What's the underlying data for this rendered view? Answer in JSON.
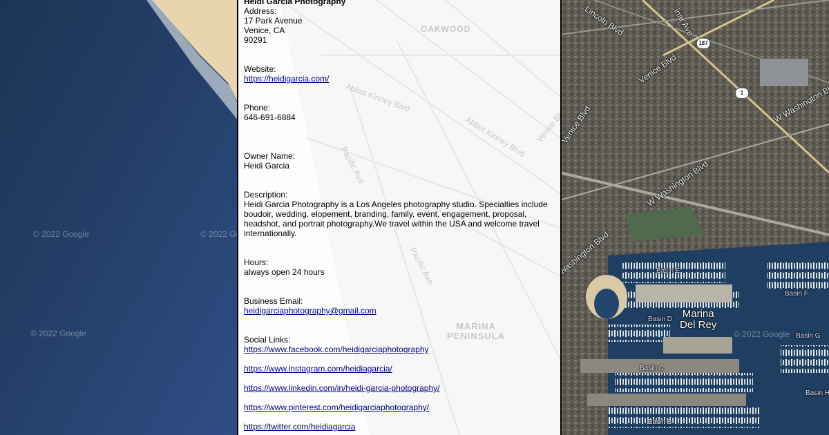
{
  "business": {
    "name": "Heidi Garcia Photography",
    "address_label": "Address:",
    "address_line1": "17 Park Avenue",
    "address_line2": "Venice, CA",
    "address_zip": "90291",
    "website_label": "Website:",
    "website": "https://heidigarcia.com/",
    "phone_label": "Phone:",
    "phone": "646-691-6884",
    "owner_label": "Owner Name:",
    "owner": "Heidi Garcia",
    "description_label": "Description:",
    "description": "Heidi Garcia Photography is a Los Angeles photography studio. Specialties include boudoir, wedding, elopement, branding, family, event, engagement, proposal, headshot, and portrait photography.We travel within the USA and welcome travel internationally.",
    "hours_label": "Hours:",
    "hours": "always open 24 hours",
    "email_label": "Business Email:",
    "email": "heidigarciaphotography@gmail.com",
    "social_label": "Social Links:",
    "social_links": [
      "https://www.facebook.com/heidigarciaphotography",
      "https://www.instagram.com/heidiagarcia/",
      "https://www.linkedin.com/in/heidi-garcia-photography/",
      "https://www.pinterest.com/heidigarciaphotography/",
      "https://twitter.com/heidiagarcia"
    ]
  },
  "map": {
    "attribution": "© 2022 Google",
    "faded_labels": {
      "oakwood": "OAKWOOD",
      "abbot_kinney_1": "Abbot Kinney Blvd",
      "abbot_kinney_2": "Abbot Kinney Blvd",
      "pacific_ave_1": "Pacific Ave",
      "pacific_ave_2": "Pacific Ave",
      "venice_blvd": "Venice Blvd",
      "marina_peninsula": "MARINA\nPENINSULA"
    },
    "road_labels": {
      "lincoln": "Lincoln Blvd",
      "venice": "Venice Blvd",
      "w_washington_1": "W Washington Blvd",
      "w_washington_2": "W Washington Blvd",
      "washington_blvd": "Washington Blvd",
      "inar_ave": "inar Ave",
      "venice_blvd_edge": "Venice Blvd"
    },
    "place_labels": {
      "marina_del_rey": "Marina\nDel Rey",
      "basin_e": "Basin E",
      "basin_d": "Basin D",
      "basin_c": "Basin C",
      "basin_b": "Basin B",
      "basin_f": "Basin F",
      "basin_g": "Basin G",
      "basin_h": "Basin H"
    },
    "shields": {
      "route_187": "187",
      "route_1": "1"
    },
    "colors": {
      "ocean": "#1e3a5c",
      "beach": "#e6d3ad",
      "urban": "#5b5850"
    }
  }
}
